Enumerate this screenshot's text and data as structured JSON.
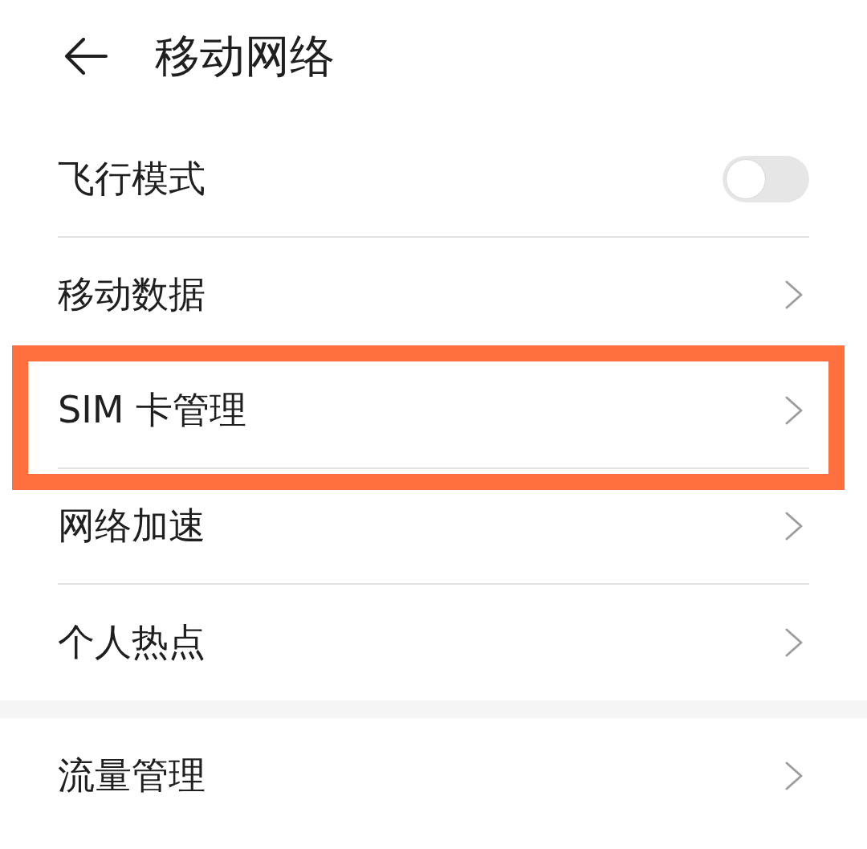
{
  "header": {
    "title": "移动网络"
  },
  "groups": [
    {
      "items": [
        {
          "label": "飞行模式",
          "kind": "toggle",
          "on": false,
          "highlighted": false
        },
        {
          "label": "移动数据",
          "kind": "link",
          "highlighted": false
        },
        {
          "label": "SIM 卡管理",
          "kind": "link",
          "highlighted": true
        },
        {
          "label": "网络加速",
          "kind": "link",
          "highlighted": false
        },
        {
          "label": "个人热点",
          "kind": "link",
          "highlighted": false
        }
      ]
    },
    {
      "items": [
        {
          "label": "流量管理",
          "kind": "link",
          "highlighted": false
        }
      ]
    }
  ]
}
